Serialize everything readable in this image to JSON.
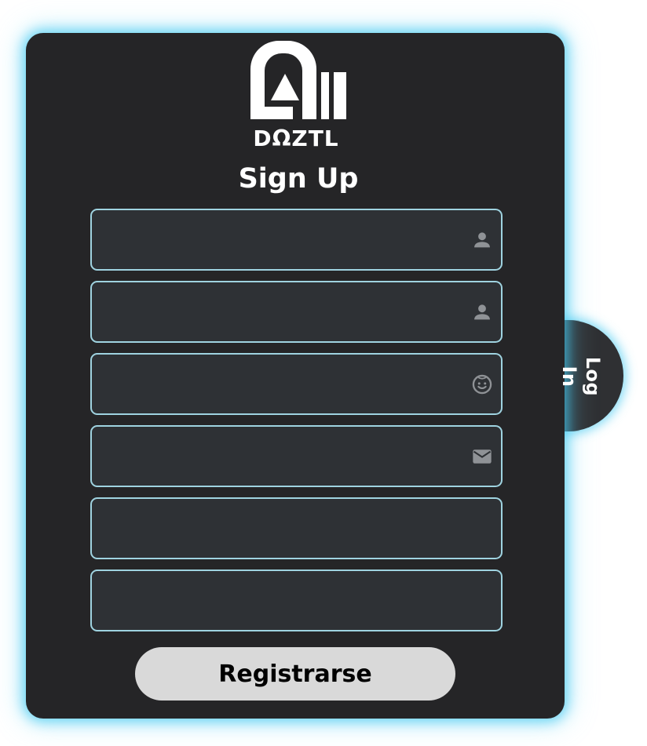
{
  "brand": {
    "logo_icon": "daztl-logo-icon",
    "wordmark": "DΩZTL"
  },
  "title": "Sign Up",
  "side_tab": {
    "label": "Log In"
  },
  "form": {
    "fields": [
      {
        "name": "first-name",
        "value": "",
        "placeholder": "",
        "icon": "person-icon"
      },
      {
        "name": "last-name",
        "value": "",
        "placeholder": "",
        "icon": "person-icon"
      },
      {
        "name": "username",
        "value": "",
        "placeholder": "",
        "icon": "face-icon"
      },
      {
        "name": "email",
        "value": "",
        "placeholder": "",
        "icon": "mail-icon"
      },
      {
        "name": "password",
        "value": "",
        "placeholder": "",
        "icon": ""
      },
      {
        "name": "confirm-password",
        "value": "",
        "placeholder": "",
        "icon": ""
      }
    ],
    "submit_label": "Registrarse"
  },
  "colors": {
    "card_bg": "#252527",
    "field_bg": "#2e3135",
    "field_border": "#9fd3e0",
    "glow": "#40c8f0",
    "button_bg": "#d9d9d9",
    "icon": "#8f9296"
  }
}
